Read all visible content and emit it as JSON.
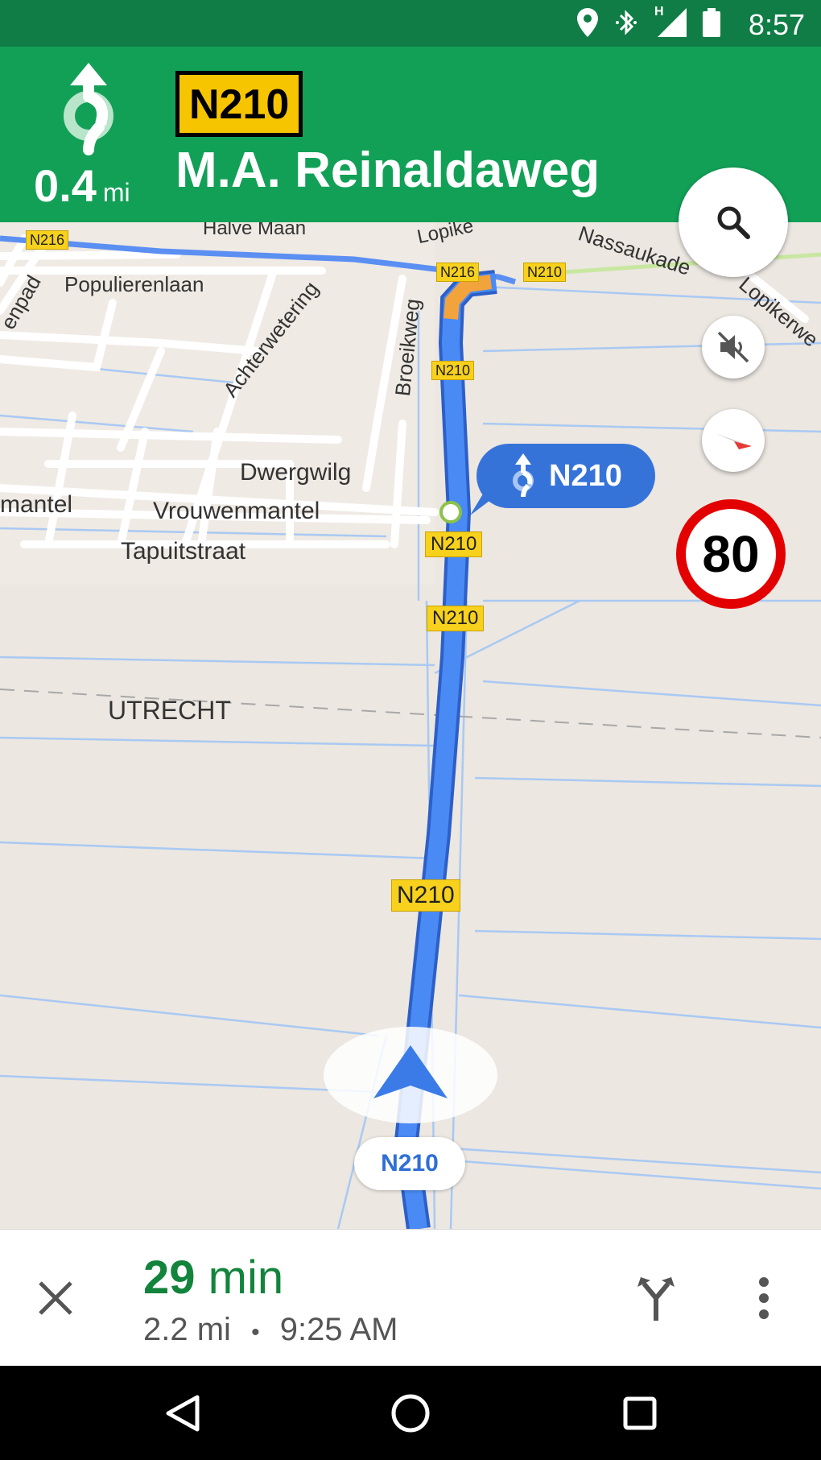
{
  "status_bar": {
    "time": "8:57",
    "icons": [
      "location-icon",
      "bluetooth-icon",
      "signal-icon",
      "battery-icon"
    ],
    "network_label": "H"
  },
  "nav_header": {
    "maneuver_icon": "roundabout-straight-icon",
    "distance_value": "0.4",
    "distance_unit": "mi",
    "road_shield": "N210",
    "street_name": "M.A. Reinaldaweg"
  },
  "map": {
    "place_labels": {
      "halve_maan": "Halve Maan",
      "lopikerweg_top": "Lopike",
      "nassaukade": "Nassaukade",
      "lopikerweg_right": "Lopikerwe",
      "populierenlaan": "Populierenlaan",
      "enpad": "enpad",
      "achterwetering": "Achterwetering",
      "broeikweg": "Broeikweg",
      "dwergwilg": "Dwergwilg",
      "mantel": "mantel",
      "vrouwenmantel": "Vrouwenmantel",
      "tapuitstraat": "Tapuitstraat",
      "utrecht": "UTRECHT"
    },
    "shields": {
      "n216_left": "N216",
      "n216_center": "N216",
      "n210_right": "N210",
      "n210_a": "N210",
      "n210_b": "N210",
      "n210_c": "N210",
      "n210_d": "N210"
    },
    "next_turn_callout": {
      "icon": "roundabout-straight-icon",
      "label": "N210"
    },
    "speed_limit": "80",
    "current_road": "N210",
    "position_icon": "navigation-arrow-icon",
    "controls": [
      "search-icon",
      "mute-icon",
      "compass-icon"
    ]
  },
  "bottom_bar": {
    "eta_minutes": "29",
    "eta_unit": "min",
    "distance": "2.2 mi",
    "separator": "•",
    "arrival_time": "9:25 AM",
    "close_icon": "close-icon",
    "routes_icon": "alternate-routes-icon",
    "menu_icon": "more-vert-icon"
  },
  "system_nav": [
    "back-icon",
    "home-icon",
    "recents-icon"
  ],
  "colors": {
    "header_green": "#12a057",
    "status_green": "#0f7d45",
    "route_blue": "#4285f4",
    "eta_green": "#12843c",
    "speed_red": "#e30000"
  }
}
